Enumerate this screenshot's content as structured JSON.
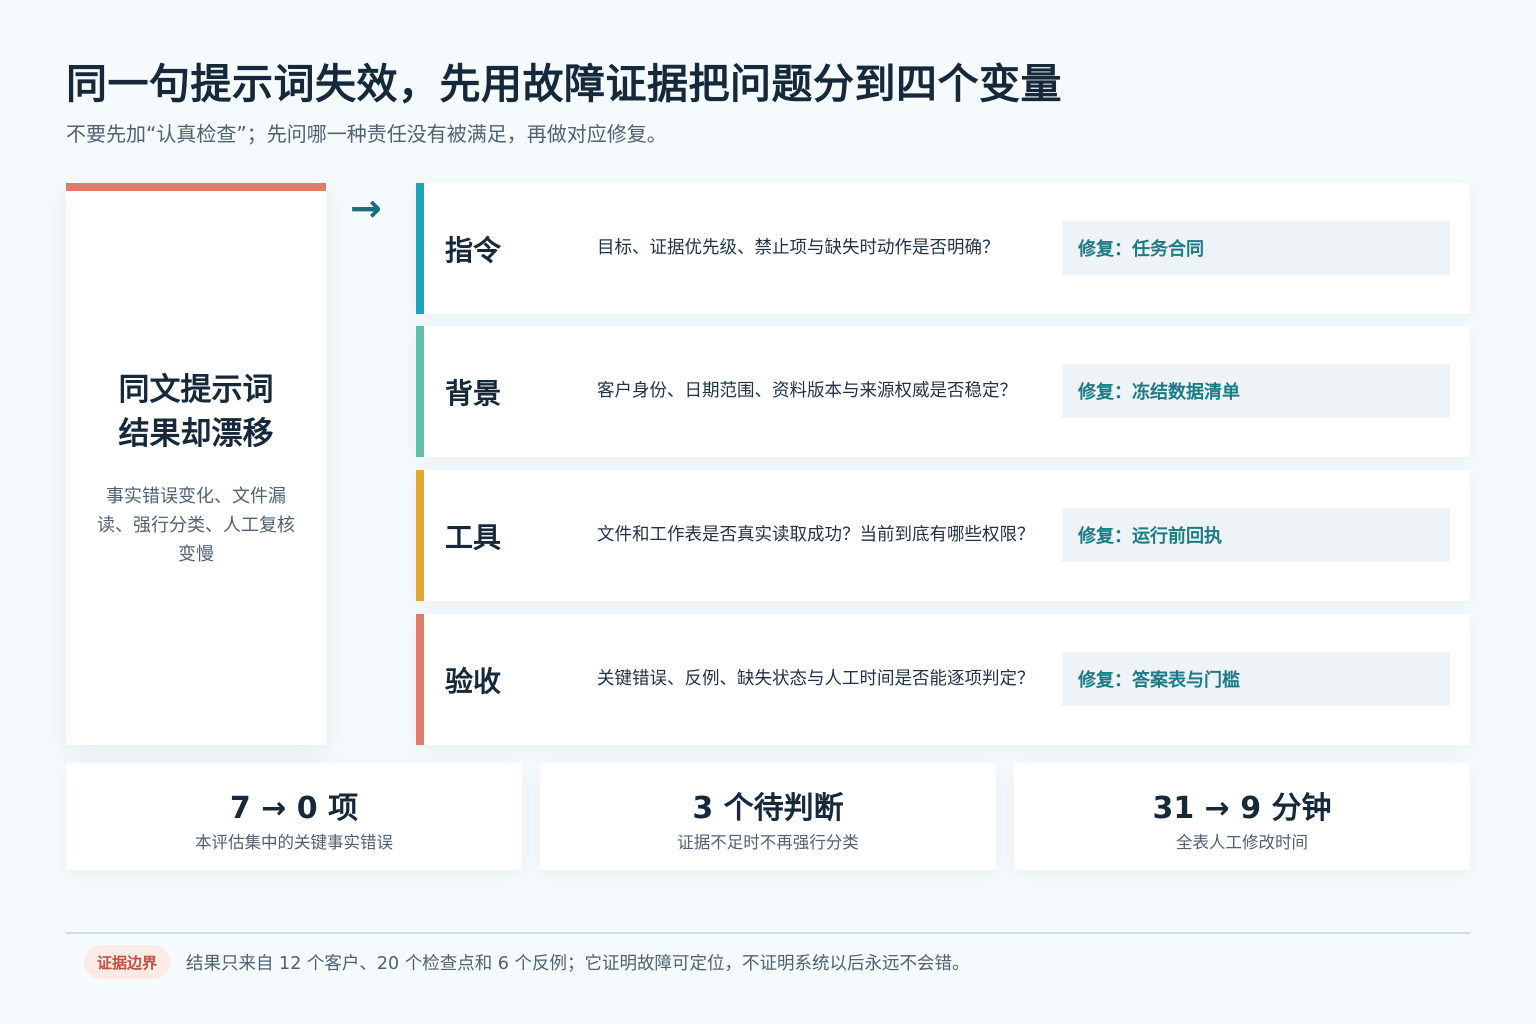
{
  "title": "同一句提示词失效，先用故障证据把问题分到四个变量",
  "subtitle": "不要先加“认真检查”；先问哪一种责任没有被满足，再做对应修复。",
  "symptom": {
    "title_line1": "同文提示词",
    "title_line2": "结果却漂移",
    "desc": "事实错误变化、文件漏读、强行分类、人工复核变慢",
    "accent_color": "#e27a6a"
  },
  "arrow": "→",
  "variables": [
    {
      "name": "指令",
      "question": "目标、证据优先级、禁止项与缺失时动作是否明确？",
      "fix": "修复：任务合同",
      "color": "#1aa3bb"
    },
    {
      "name": "背景",
      "question": "客户身份、日期范围、资料版本与来源权威是否稳定？",
      "fix": "修复：冻结数据清单",
      "color": "#5fbfa9"
    },
    {
      "name": "工具",
      "question": "文件和工作表是否真实读取成功？当前到底有哪些权限？",
      "fix": "修复：运行前回执",
      "color": "#e3a530"
    },
    {
      "name": "验收",
      "question": "关键错误、反例、缺失状态与人工时间是否能逐项判定？",
      "fix": "修复：答案表与门槛",
      "color": "#e27a6a"
    }
  ],
  "stats": [
    {
      "value": "7 → 0 项",
      "label": "本评估集中的关键事实错误"
    },
    {
      "value": "3 个待判断",
      "label": "证据不足时不再强行分类"
    },
    {
      "value": "31 → 9 分钟",
      "label": "全表人工修改时间"
    }
  ],
  "footer": {
    "badge": "证据边界",
    "text": "结果只来自 12 个客户、20 个检查点和 6 个反例；它证明故障可定位，不证明系统以后永远不会错。"
  }
}
